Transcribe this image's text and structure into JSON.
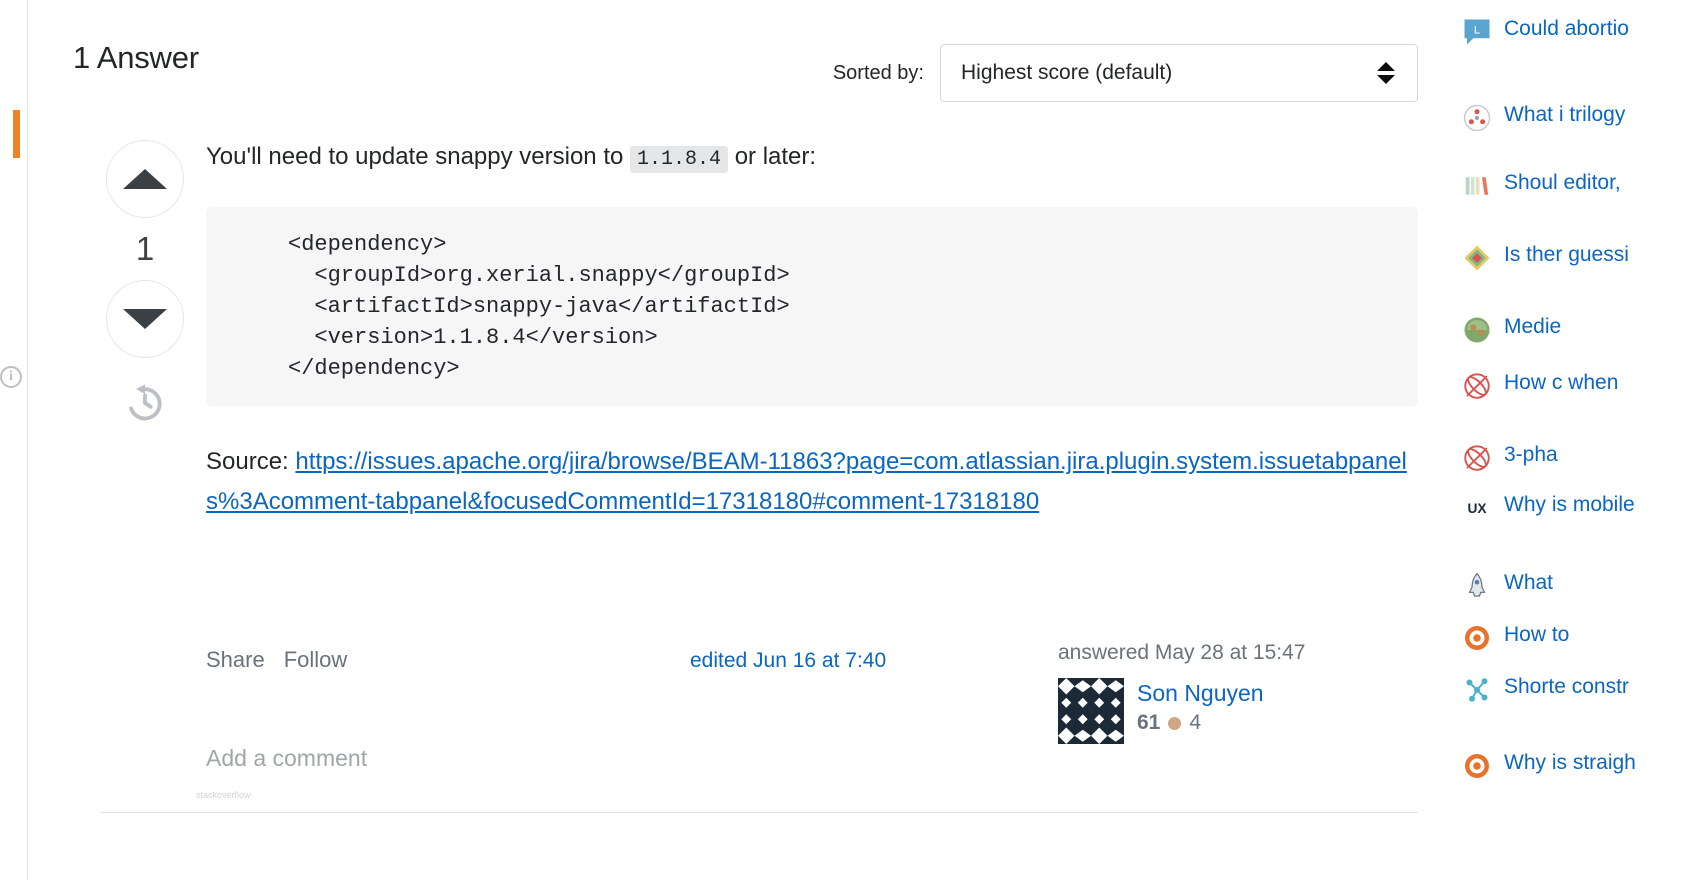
{
  "answers": {
    "title": "1 Answer",
    "sort_label": "Sorted by:",
    "sort_value": "Highest score (default)"
  },
  "answer": {
    "vote_count": "1",
    "upvote_icon": "arrow-up-icon",
    "downvote_icon": "arrow-down-icon",
    "history_icon": "history-clock-icon",
    "intro_before": "You'll need to update snappy version to",
    "intro_code": "1.1.8.4",
    "intro_after": "or later:",
    "code_block": "<dependency>\n  <groupId>org.xerial.snappy</groupId>\n  <artifactId>snappy-java</artifactId>\n  <version>1.1.8.4</version>\n</dependency>",
    "source_prefix": "Source:",
    "source_url": "https://issues.apache.org/jira/browse/BEAM-11863?page=com.atlassian.jira.plugin.system.issuetabpanels%3Acomment-tabpanel&focusedCommentId=17318180#comment-17318180",
    "share_label": "Share",
    "follow_label": "Follow",
    "edited_label": "edited Jun 16 at 7:40",
    "answered_label": "answered May 28 at 15:47",
    "author_name": "Son Nguyen",
    "author_rep": "61",
    "author_bronze_badges": "4",
    "avatar_icon": "identicon-avatar",
    "add_comment_label": "Add a comment"
  },
  "sidebar": {
    "hot_questions": [
      {
        "icon": "law-stackexchange-icon",
        "text": "Could abortio"
      },
      {
        "icon": "scifi-stackexchange-icon",
        "text": "What i trilogy"
      },
      {
        "icon": "writing-stackexchange-icon",
        "text": "Shoul editor,"
      },
      {
        "icon": "puzzling-stackexchange-icon",
        "text": "Is ther guessi"
      },
      {
        "icon": "history-stackexchange-icon",
        "text": "Medie"
      },
      {
        "icon": "physics-stackexchange-icon",
        "text": "How c when "
      },
      {
        "icon": "physics-stackexchange-icon",
        "text": "3-pha"
      },
      {
        "icon": "ux-stackexchange-icon",
        "text": "Why is mobile"
      },
      {
        "icon": "space-stackexchange-icon",
        "text": "What "
      },
      {
        "icon": "target-stackexchange-icon",
        "text": "How to"
      },
      {
        "icon": "network-stackexchange-icon",
        "text": "Shorte constr"
      },
      {
        "icon": "target-stackexchange-icon",
        "text": "Why is straigh"
      }
    ]
  },
  "colors": {
    "link": "#0a66c2",
    "accent_orange": "#f48024",
    "muted": "#6a737c",
    "code_bg": "#f6f6f6"
  }
}
